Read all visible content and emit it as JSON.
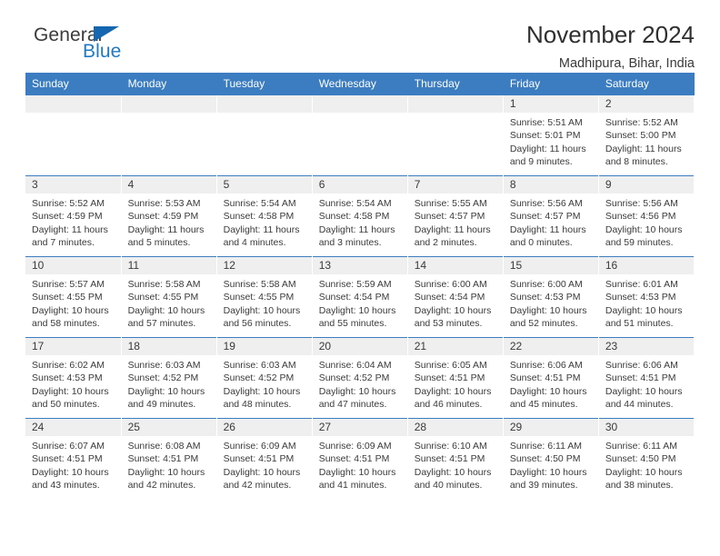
{
  "logo": {
    "word_one": "General",
    "word_two": "Blue",
    "triangle_icon": "triangle-icon"
  },
  "header": {
    "title": "November 2024",
    "location": "Madhipura, Bihar, India"
  },
  "colors": {
    "header_blue": "#3b7dc0",
    "daynum_gray": "#efefef",
    "logo_blue": "#1f7ac4",
    "text": "#3a3a3a"
  },
  "weekday_headers": [
    "Sunday",
    "Monday",
    "Tuesday",
    "Wednesday",
    "Thursday",
    "Friday",
    "Saturday"
  ],
  "weeks": [
    [
      {
        "day": "",
        "sunrise": "",
        "sunset": "",
        "daylight": ""
      },
      {
        "day": "",
        "sunrise": "",
        "sunset": "",
        "daylight": ""
      },
      {
        "day": "",
        "sunrise": "",
        "sunset": "",
        "daylight": ""
      },
      {
        "day": "",
        "sunrise": "",
        "sunset": "",
        "daylight": ""
      },
      {
        "day": "",
        "sunrise": "",
        "sunset": "",
        "daylight": ""
      },
      {
        "day": "1",
        "sunrise": "Sunrise: 5:51 AM",
        "sunset": "Sunset: 5:01 PM",
        "daylight": "Daylight: 11 hours and 9 minutes."
      },
      {
        "day": "2",
        "sunrise": "Sunrise: 5:52 AM",
        "sunset": "Sunset: 5:00 PM",
        "daylight": "Daylight: 11 hours and 8 minutes."
      }
    ],
    [
      {
        "day": "3",
        "sunrise": "Sunrise: 5:52 AM",
        "sunset": "Sunset: 4:59 PM",
        "daylight": "Daylight: 11 hours and 7 minutes."
      },
      {
        "day": "4",
        "sunrise": "Sunrise: 5:53 AM",
        "sunset": "Sunset: 4:59 PM",
        "daylight": "Daylight: 11 hours and 5 minutes."
      },
      {
        "day": "5",
        "sunrise": "Sunrise: 5:54 AM",
        "sunset": "Sunset: 4:58 PM",
        "daylight": "Daylight: 11 hours and 4 minutes."
      },
      {
        "day": "6",
        "sunrise": "Sunrise: 5:54 AM",
        "sunset": "Sunset: 4:58 PM",
        "daylight": "Daylight: 11 hours and 3 minutes."
      },
      {
        "day": "7",
        "sunrise": "Sunrise: 5:55 AM",
        "sunset": "Sunset: 4:57 PM",
        "daylight": "Daylight: 11 hours and 2 minutes."
      },
      {
        "day": "8",
        "sunrise": "Sunrise: 5:56 AM",
        "sunset": "Sunset: 4:57 PM",
        "daylight": "Daylight: 11 hours and 0 minutes."
      },
      {
        "day": "9",
        "sunrise": "Sunrise: 5:56 AM",
        "sunset": "Sunset: 4:56 PM",
        "daylight": "Daylight: 10 hours and 59 minutes."
      }
    ],
    [
      {
        "day": "10",
        "sunrise": "Sunrise: 5:57 AM",
        "sunset": "Sunset: 4:55 PM",
        "daylight": "Daylight: 10 hours and 58 minutes."
      },
      {
        "day": "11",
        "sunrise": "Sunrise: 5:58 AM",
        "sunset": "Sunset: 4:55 PM",
        "daylight": "Daylight: 10 hours and 57 minutes."
      },
      {
        "day": "12",
        "sunrise": "Sunrise: 5:58 AM",
        "sunset": "Sunset: 4:55 PM",
        "daylight": "Daylight: 10 hours and 56 minutes."
      },
      {
        "day": "13",
        "sunrise": "Sunrise: 5:59 AM",
        "sunset": "Sunset: 4:54 PM",
        "daylight": "Daylight: 10 hours and 55 minutes."
      },
      {
        "day": "14",
        "sunrise": "Sunrise: 6:00 AM",
        "sunset": "Sunset: 4:54 PM",
        "daylight": "Daylight: 10 hours and 53 minutes."
      },
      {
        "day": "15",
        "sunrise": "Sunrise: 6:00 AM",
        "sunset": "Sunset: 4:53 PM",
        "daylight": "Daylight: 10 hours and 52 minutes."
      },
      {
        "day": "16",
        "sunrise": "Sunrise: 6:01 AM",
        "sunset": "Sunset: 4:53 PM",
        "daylight": "Daylight: 10 hours and 51 minutes."
      }
    ],
    [
      {
        "day": "17",
        "sunrise": "Sunrise: 6:02 AM",
        "sunset": "Sunset: 4:53 PM",
        "daylight": "Daylight: 10 hours and 50 minutes."
      },
      {
        "day": "18",
        "sunrise": "Sunrise: 6:03 AM",
        "sunset": "Sunset: 4:52 PM",
        "daylight": "Daylight: 10 hours and 49 minutes."
      },
      {
        "day": "19",
        "sunrise": "Sunrise: 6:03 AM",
        "sunset": "Sunset: 4:52 PM",
        "daylight": "Daylight: 10 hours and 48 minutes."
      },
      {
        "day": "20",
        "sunrise": "Sunrise: 6:04 AM",
        "sunset": "Sunset: 4:52 PM",
        "daylight": "Daylight: 10 hours and 47 minutes."
      },
      {
        "day": "21",
        "sunrise": "Sunrise: 6:05 AM",
        "sunset": "Sunset: 4:51 PM",
        "daylight": "Daylight: 10 hours and 46 minutes."
      },
      {
        "day": "22",
        "sunrise": "Sunrise: 6:06 AM",
        "sunset": "Sunset: 4:51 PM",
        "daylight": "Daylight: 10 hours and 45 minutes."
      },
      {
        "day": "23",
        "sunrise": "Sunrise: 6:06 AM",
        "sunset": "Sunset: 4:51 PM",
        "daylight": "Daylight: 10 hours and 44 minutes."
      }
    ],
    [
      {
        "day": "24",
        "sunrise": "Sunrise: 6:07 AM",
        "sunset": "Sunset: 4:51 PM",
        "daylight": "Daylight: 10 hours and 43 minutes."
      },
      {
        "day": "25",
        "sunrise": "Sunrise: 6:08 AM",
        "sunset": "Sunset: 4:51 PM",
        "daylight": "Daylight: 10 hours and 42 minutes."
      },
      {
        "day": "26",
        "sunrise": "Sunrise: 6:09 AM",
        "sunset": "Sunset: 4:51 PM",
        "daylight": "Daylight: 10 hours and 42 minutes."
      },
      {
        "day": "27",
        "sunrise": "Sunrise: 6:09 AM",
        "sunset": "Sunset: 4:51 PM",
        "daylight": "Daylight: 10 hours and 41 minutes."
      },
      {
        "day": "28",
        "sunrise": "Sunrise: 6:10 AM",
        "sunset": "Sunset: 4:51 PM",
        "daylight": "Daylight: 10 hours and 40 minutes."
      },
      {
        "day": "29",
        "sunrise": "Sunrise: 6:11 AM",
        "sunset": "Sunset: 4:50 PM",
        "daylight": "Daylight: 10 hours and 39 minutes."
      },
      {
        "day": "30",
        "sunrise": "Sunrise: 6:11 AM",
        "sunset": "Sunset: 4:50 PM",
        "daylight": "Daylight: 10 hours and 38 minutes."
      }
    ]
  ]
}
